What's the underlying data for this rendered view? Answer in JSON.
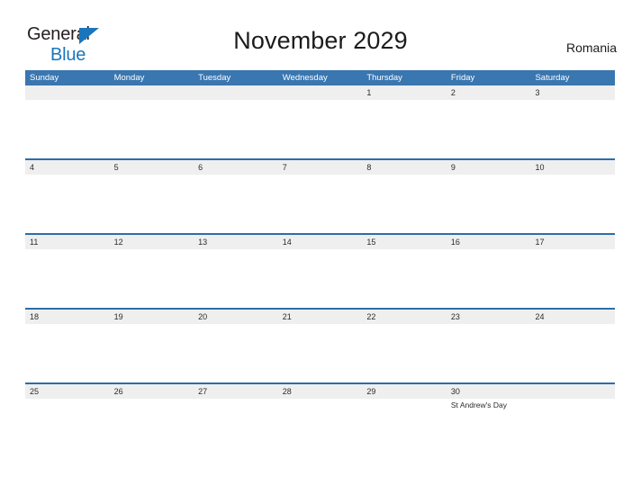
{
  "brand": {
    "name_part1": "General",
    "name_part2": "Blue",
    "triangle_color": "#1a76bc"
  },
  "header": {
    "title": "November 2029",
    "country": "Romania"
  },
  "calendar": {
    "month": "November",
    "year": "2029",
    "header_bg_color": "#3a76b0",
    "date_band_color": "#efefef",
    "row_divider_color": "#2e6da8",
    "weekdays": [
      "Sunday",
      "Monday",
      "Tuesday",
      "Wednesday",
      "Thursday",
      "Friday",
      "Saturday"
    ],
    "weeks": [
      [
        {
          "date": "",
          "events": []
        },
        {
          "date": "",
          "events": []
        },
        {
          "date": "",
          "events": []
        },
        {
          "date": "",
          "events": []
        },
        {
          "date": "1",
          "events": []
        },
        {
          "date": "2",
          "events": []
        },
        {
          "date": "3",
          "events": []
        }
      ],
      [
        {
          "date": "4",
          "events": []
        },
        {
          "date": "5",
          "events": []
        },
        {
          "date": "6",
          "events": []
        },
        {
          "date": "7",
          "events": []
        },
        {
          "date": "8",
          "events": []
        },
        {
          "date": "9",
          "events": []
        },
        {
          "date": "10",
          "events": []
        }
      ],
      [
        {
          "date": "11",
          "events": []
        },
        {
          "date": "12",
          "events": []
        },
        {
          "date": "13",
          "events": []
        },
        {
          "date": "14",
          "events": []
        },
        {
          "date": "15",
          "events": []
        },
        {
          "date": "16",
          "events": []
        },
        {
          "date": "17",
          "events": []
        }
      ],
      [
        {
          "date": "18",
          "events": []
        },
        {
          "date": "19",
          "events": []
        },
        {
          "date": "20",
          "events": []
        },
        {
          "date": "21",
          "events": []
        },
        {
          "date": "22",
          "events": []
        },
        {
          "date": "23",
          "events": []
        },
        {
          "date": "24",
          "events": []
        }
      ],
      [
        {
          "date": "25",
          "events": []
        },
        {
          "date": "26",
          "events": []
        },
        {
          "date": "27",
          "events": []
        },
        {
          "date": "28",
          "events": []
        },
        {
          "date": "29",
          "events": []
        },
        {
          "date": "30",
          "events": [
            "St Andrew's Day"
          ]
        },
        {
          "date": "",
          "events": []
        }
      ]
    ]
  }
}
